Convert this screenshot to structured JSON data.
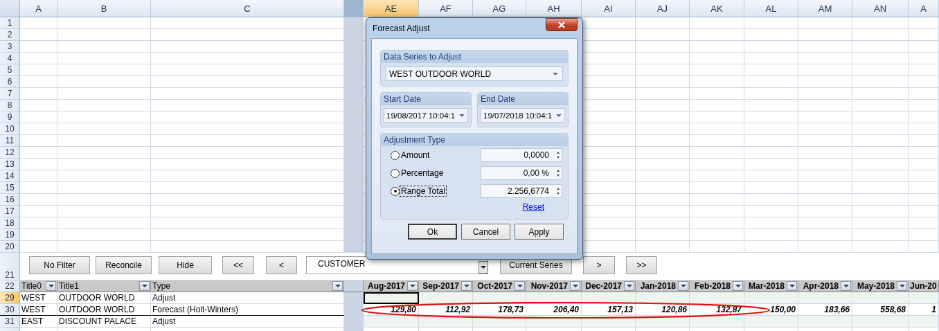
{
  "sheet": {
    "columns": [
      {
        "label": "A",
        "selected": false
      },
      {
        "label": "B",
        "selected": false
      },
      {
        "label": "C",
        "selected": false
      },
      {
        "label": "AE",
        "selected": true
      },
      {
        "label": "AF",
        "selected": false
      },
      {
        "label": "AG",
        "selected": false
      },
      {
        "label": "AH",
        "selected": false
      },
      {
        "label": "AI",
        "selected": false
      },
      {
        "label": "AJ",
        "selected": false
      },
      {
        "label": "AK",
        "selected": false
      },
      {
        "label": "AL",
        "selected": false
      },
      {
        "label": "AM",
        "selected": false
      },
      {
        "label": "AN",
        "selected": false
      },
      {
        "label": "A",
        "selected": false
      }
    ],
    "empty_rows": [
      "1",
      "2",
      "3",
      "4",
      "5",
      "6",
      "7",
      "8",
      "9",
      "10",
      "11",
      "12",
      "13",
      "14",
      "15",
      "16",
      "17",
      "18",
      "19",
      "20"
    ],
    "control_row": {
      "number": "21",
      "buttons_left": [
        "No Filter",
        "Reconcile",
        "Hide",
        "<<",
        "<"
      ],
      "combo": {
        "value": "CUSTOMER"
      },
      "buttons_right": [
        "Current Series",
        ">",
        ">>"
      ]
    },
    "header_row": {
      "number": "22",
      "left": [
        "Title0",
        "Title1",
        "Type"
      ],
      "months": [
        "Aug-2017",
        "Sep-2017",
        "Oct-2017",
        "Nov-2017",
        "Dec-2017",
        "Jan-2018",
        "Feb-2018",
        "Mar-2018",
        "Apr-2018",
        "May-2018",
        "Jun-20"
      ]
    },
    "rows": [
      {
        "number": "29",
        "selected": true,
        "kind": "adjust",
        "title0": "WEST",
        "title1": "OUTDOOR WORLD",
        "type": "Adjust",
        "values": []
      },
      {
        "number": "30",
        "selected": false,
        "kind": "forecast",
        "title0": "WEST",
        "title1": "OUTDOOR WORLD",
        "type": "Forecast (Holt-Winters)",
        "values": [
          "129,80",
          "112,92",
          "178,73",
          "206,40",
          "157,13",
          "120,86",
          "132,87",
          "150,00",
          "183,66",
          "558,68",
          "1"
        ]
      },
      {
        "number": "31",
        "selected": false,
        "kind": "adjust",
        "title0": "EAST",
        "title1": "DISCOUNT PALACE",
        "type": "Adjust",
        "values": []
      }
    ]
  },
  "dialog": {
    "title": "Forecast Adjust",
    "series_group": {
      "label": "Data Series to Adjust",
      "value": "WEST OUTDOOR WORLD"
    },
    "start_date": {
      "label": "Start Date",
      "value": "19/08/2017 10:04:1"
    },
    "end_date": {
      "label": "End Date",
      "value": "19/07/2018 10:04:1"
    },
    "adjustment": {
      "label": "Adjustment Type",
      "options": [
        {
          "label": "Amount",
          "selected": false,
          "value": "0,0000"
        },
        {
          "label": "Percentage",
          "selected": false,
          "value": "0,00 %"
        },
        {
          "label": "Range Total",
          "selected": true,
          "value": "2.256,6774"
        }
      ],
      "reset": "Reset"
    },
    "buttons": [
      {
        "label": "Ok",
        "default": true
      },
      {
        "label": "Cancel",
        "default": false
      },
      {
        "label": "Apply",
        "default": false
      }
    ]
  }
}
